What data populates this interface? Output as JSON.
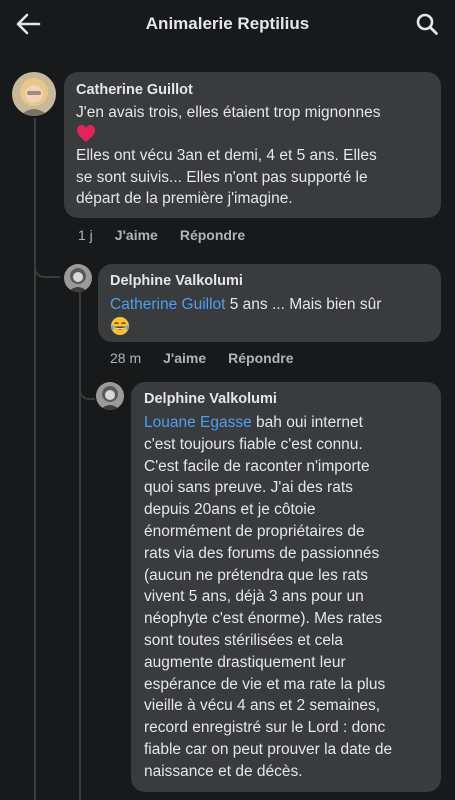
{
  "header": {
    "title": "Animalerie Reptilius",
    "back_icon": "arrow-left-icon",
    "search_icon": "search-icon"
  },
  "colors": {
    "background": "#18191a",
    "bubble": "#3a3b3c",
    "mention": "#4e9ef2",
    "heart": "#e0245e"
  },
  "comments": [
    {
      "author": "Catherine Guillot",
      "line1": "J'en avais trois, elles étaient trop mignonnes",
      "emoji": "heart",
      "line2": "Elles ont vécu 3an et demi, 4 et 5 ans. Elles",
      "line3": "se sont suivis... Elles n'ont pas supporté le",
      "line4": "départ de la première j'imagine.",
      "time": "1 j",
      "like": "J'aime",
      "reply": "Répondre"
    },
    {
      "author": "Delphine Valkolumi",
      "mention": "Catherine Guillot",
      "text": " 5 ans ... Mais bien sûr",
      "emoji": "face-with-tears-of-joy",
      "time": "28 m",
      "like": "J'aime",
      "reply": "Répondre"
    },
    {
      "author": "Delphine Valkolumi",
      "mention": "Louane Egasse",
      "first_line": " bah oui internet",
      "lines": [
        "c'est toujours fiable c'est connu.",
        "C'est facile de raconter n'importe",
        "quoi sans preuve. J'ai des rats",
        "depuis 20ans et je côtoie",
        "énormément de propriétaires de",
        "rats via des forums de passionnés",
        "(aucun ne prétendra que les rats",
        "vivent 5 ans, déjà 3 ans pour un",
        "néophyte c'est énorme). Mes rates",
        "sont toutes stérilisées et cela",
        "augmente drastiquement leur",
        "espérance de vie et ma rate la plus",
        "vieille à vécu 4 ans et 2 semaines,",
        "record enregistré sur le Lord : donc",
        "fiable car on peut prouver la date de",
        "naissance et de décès."
      ]
    }
  ]
}
